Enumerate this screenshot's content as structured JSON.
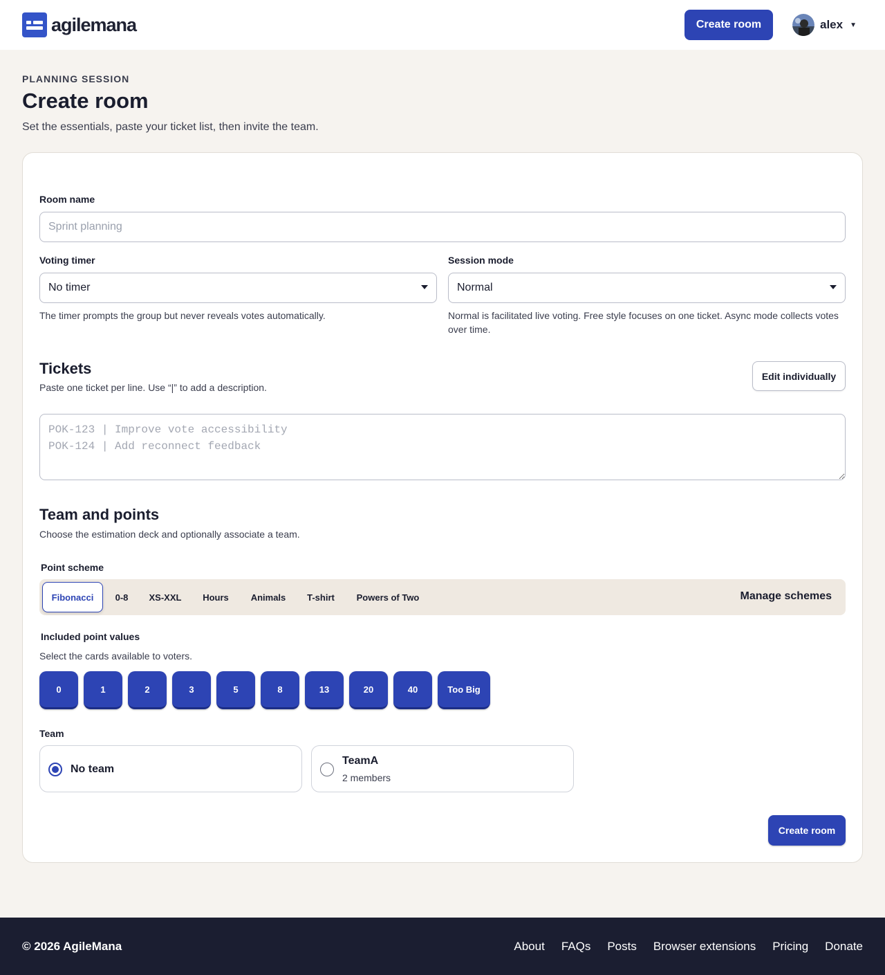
{
  "header": {
    "brand": "agilemana",
    "create_label": "Create room",
    "user": {
      "name": "alex"
    }
  },
  "page": {
    "eyebrow": "PLANNING SESSION",
    "title": "Create room",
    "subtitle": "Set the essentials, paste your ticket list, then invite the team."
  },
  "form": {
    "room_name": {
      "label": "Room name",
      "placeholder": "Sprint planning",
      "value": ""
    },
    "voting_timer": {
      "label": "Voting timer",
      "value": "No timer",
      "help": "The timer prompts the group but never reveals votes automatically."
    },
    "session_mode": {
      "label": "Session mode",
      "value": "Normal",
      "help": "Normal is facilitated live voting. Free style focuses on one ticket. Async mode collects votes over time."
    },
    "tickets": {
      "title": "Tickets",
      "subtitle": "Paste one ticket per line. Use “|” to add a description.",
      "edit_label": "Edit individually",
      "placeholder": "POK-123 | Improve vote accessibility\nPOK-124 | Add reconnect feedback"
    },
    "team_points": {
      "title": "Team and points",
      "subtitle": "Choose the estimation deck and optionally associate a team."
    },
    "point_scheme": {
      "label": "Point scheme",
      "tabs": [
        "Fibonacci",
        "0-8",
        "XS-XXL",
        "Hours",
        "Animals",
        "T-shirt",
        "Powers of Two"
      ],
      "selected": "Fibonacci",
      "manage_label": "Manage schemes"
    },
    "point_values": {
      "label": "Included point values",
      "help": "Select the cards available to voters.",
      "values": [
        "0",
        "1",
        "2",
        "3",
        "5",
        "8",
        "13",
        "20",
        "40",
        "Too Big"
      ]
    },
    "team": {
      "label": "Team",
      "options": [
        {
          "name": "No team",
          "meta": "",
          "selected": true
        },
        {
          "name": "TeamA",
          "meta": "2 members",
          "selected": false
        }
      ]
    },
    "submit_label": "Create room"
  },
  "footer": {
    "copyright": "© 2026 AgileMana",
    "links": [
      "About",
      "FAQs",
      "Posts",
      "Browser extensions",
      "Pricing",
      "Donate"
    ]
  },
  "colors": {
    "accent": "#2d44b4",
    "page_bg": "#f6f3ef",
    "footer_bg": "#1b1e31",
    "scheme_bar_bg": "#efe9e1"
  }
}
